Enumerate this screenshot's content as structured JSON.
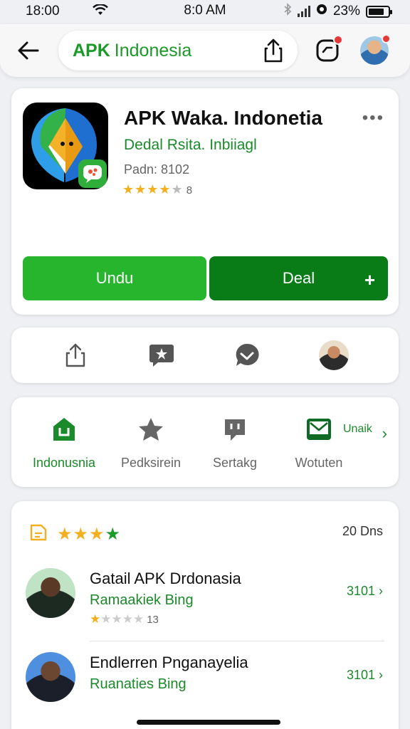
{
  "status_bar": {
    "time_left": "18:00",
    "time_center": "8:0 AM",
    "battery": "23%",
    "battery_level": 0.8
  },
  "topbar": {
    "brand": "APK",
    "search_text": "Indonesia"
  },
  "app": {
    "title": "APK Waka. Indonetia",
    "developer": "Dedal Rsita. Inbiiagl",
    "meta": "Padn: 8102",
    "rating_stars": "★★★★",
    "rating_dim": "★",
    "rating_count": "8",
    "more": "•••",
    "install_label": "Undu",
    "open_label": "Deal",
    "open_plus": "+"
  },
  "tabs": [
    {
      "label": "Indonusnia"
    },
    {
      "label": "Pedksirein"
    },
    {
      "label": "Sertakg"
    },
    {
      "label": "Wotuten",
      "side_label": "Unaik"
    }
  ],
  "reviews": {
    "header_stars": "★★★",
    "header_star_green": "★",
    "count": "20 Dns",
    "items": [
      {
        "name": "Gatail APK Drdonasia",
        "subtitle": "Ramaakiek Bing",
        "stars": "★",
        "stars_dim": "★★★★",
        "stars_count": "13",
        "link": "3101 ›"
      },
      {
        "name": "Endlerren Pnganayelia",
        "subtitle": "Ruanaties Bing",
        "link": "3101 ›"
      }
    ]
  },
  "colors": {
    "brand_green": "#1b9a2a",
    "install_green": "#27b52d",
    "open_green": "#0a7c17",
    "star_gold": "#f2b01e"
  }
}
